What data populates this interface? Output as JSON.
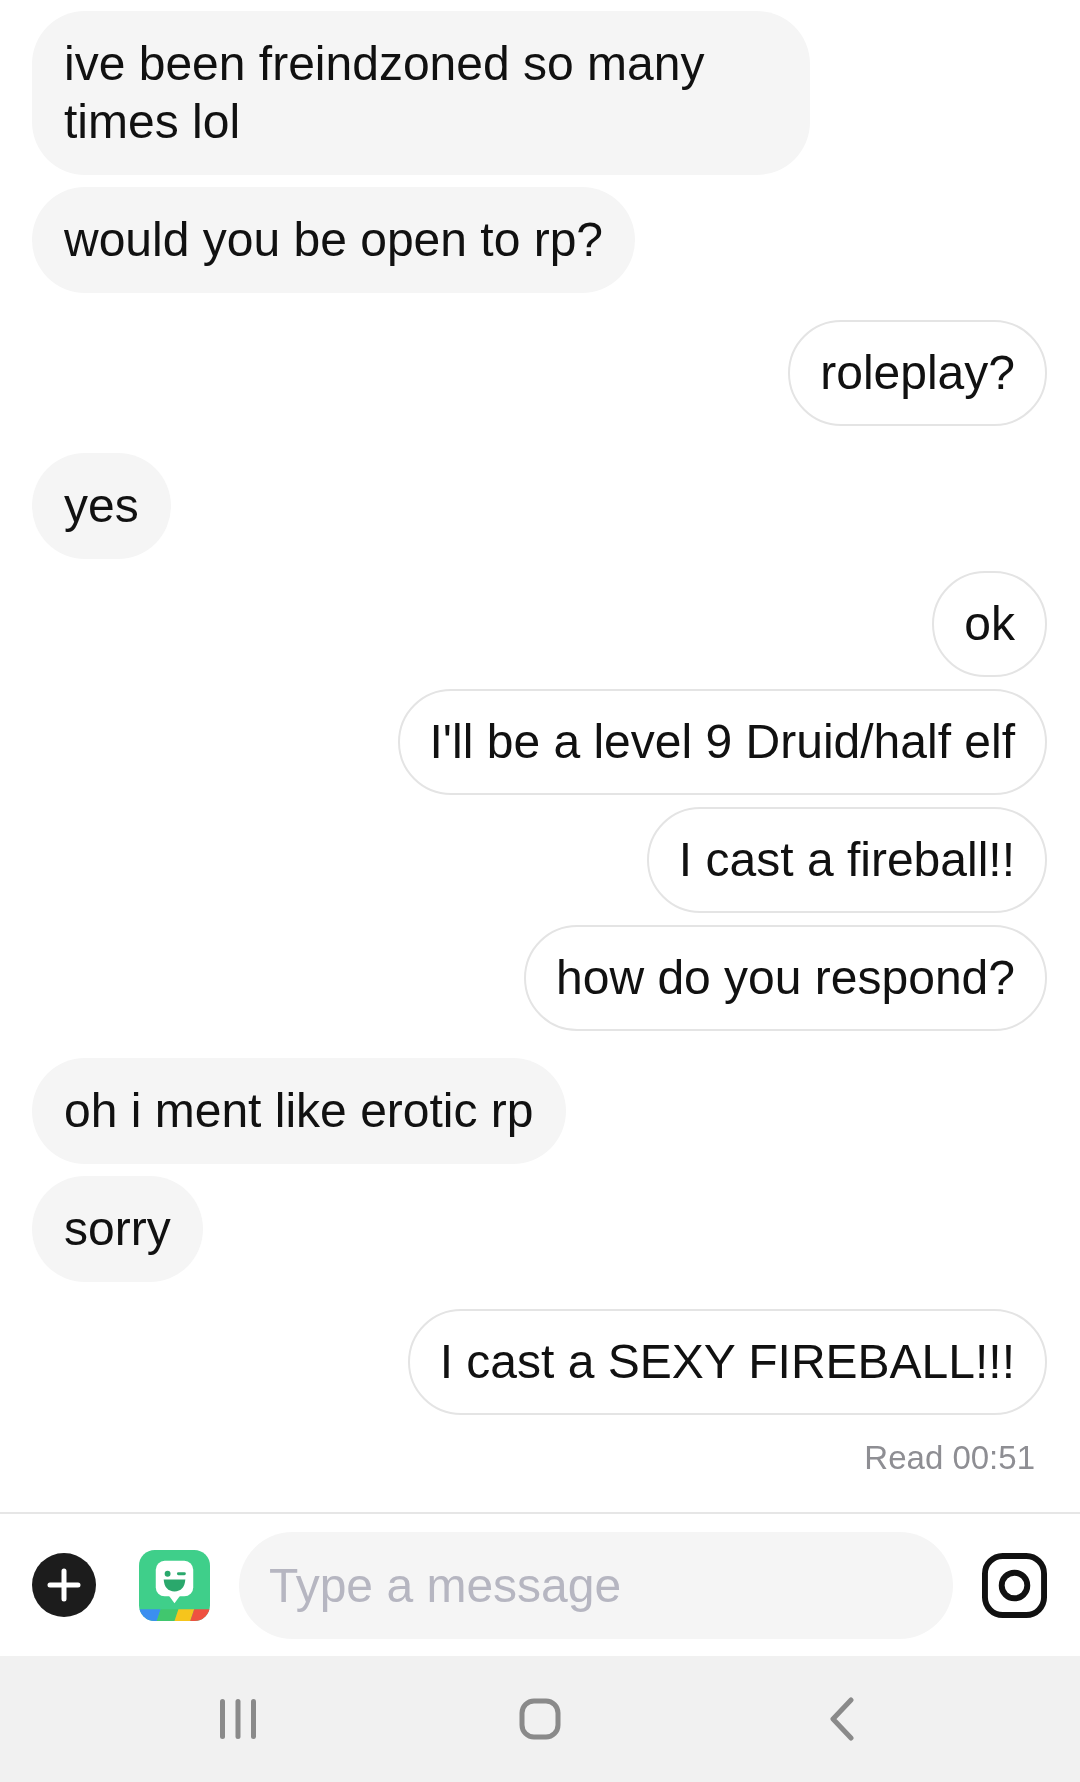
{
  "message_groups": [
    {
      "messages": [
        {
          "kind": "received",
          "text": "ive been freindzoned so many times lol"
        },
        {
          "kind": "received",
          "text": "would you be open to rp?"
        }
      ]
    },
    {
      "messages": [
        {
          "kind": "sent",
          "text": "roleplay?"
        }
      ]
    },
    {
      "messages": [
        {
          "kind": "received",
          "text": "yes"
        },
        {
          "kind": "sent",
          "text": "ok"
        },
        {
          "kind": "sent",
          "text": "I'll be a level 9 Druid/half elf"
        },
        {
          "kind": "sent",
          "text": "I cast a fireball!!"
        },
        {
          "kind": "sent",
          "text": "how do you respond?"
        }
      ]
    },
    {
      "messages": [
        {
          "kind": "received",
          "text": "oh i ment like erotic rp"
        },
        {
          "kind": "received",
          "text": "sorry"
        }
      ]
    },
    {
      "messages": [
        {
          "kind": "sent",
          "text": "I cast a SEXY FIREBALL!!!"
        }
      ]
    }
  ],
  "read_receipt": "Read 00:51",
  "composer": {
    "placeholder": "Type a message"
  }
}
